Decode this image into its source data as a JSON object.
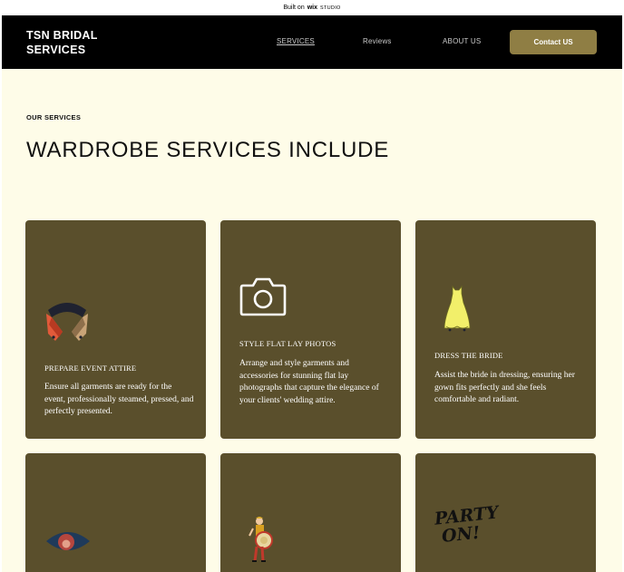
{
  "wix_bar": {
    "prefix": "Built on",
    "logo": "wix",
    "suffix": "STUDIO"
  },
  "header": {
    "brand": "TSN BRIDAL SERVICES",
    "nav": [
      "SERVICES",
      "Reviews",
      "ABOUT US"
    ],
    "contact_label": "Contact US"
  },
  "section": {
    "eyebrow": "OUR SERVICES",
    "title": "WARDROBE SERVICES INCLUDE"
  },
  "cards": [
    {
      "icon": "jacket-collar-icon",
      "title": "PREPARE EVENT ATTIRE",
      "desc": "Ensure all garments are ready for the event, professionally steamed, pressed, and perfectly presented."
    },
    {
      "icon": "camera-icon",
      "title": "STYLE FLAT LAY PHOTOS",
      "desc": "Arrange and style garments and accessories for stunning flat lay photographs that capture the elegance of your clients' wedding attire."
    },
    {
      "icon": "dress-icon",
      "title": "DRESS THE BRIDE",
      "desc": "Assist the bride in dressing, ensuring her gown fits perfectly and she feels comfortable and radiant."
    },
    {
      "icon": "eye-icon",
      "title": "",
      "desc": ""
    },
    {
      "icon": "drummer-icon",
      "title": "",
      "desc": ""
    },
    {
      "icon": "party-on-icon",
      "title": "",
      "desc": "",
      "icon_text": [
        "PARTY",
        "ON!"
      ]
    }
  ],
  "colors": {
    "page_bg": "#fefce8",
    "header_bg": "#000000",
    "card_bg": "#5a4f2c",
    "button_bg": "#8f7e44"
  }
}
